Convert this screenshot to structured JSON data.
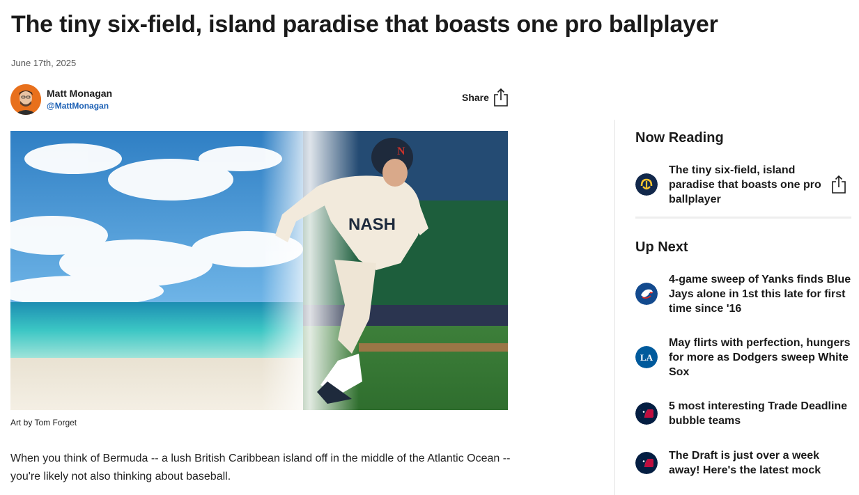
{
  "article": {
    "headline": "The tiny six-field, island paradise that boasts one pro ballplayer",
    "date": "June 17th, 2025",
    "author": {
      "name": "Matt Monagan",
      "handle": "@MattMonagan"
    },
    "share_label": "Share",
    "hero_caption": "Art by Tom Forget",
    "body": "When you think of Bermuda -- a lush British Caribbean island off in the middle of the Atlantic Ocean -- you're likely not also thinking about baseball.",
    "hero_jersey_text": "NASH",
    "hero_helmet_letter": "N"
  },
  "sidebar": {
    "now_reading_heading": "Now Reading",
    "now_reading": {
      "title": "The tiny six-field, island paradise that boasts one pro ballplayer",
      "logo": "brewers-logo-icon"
    },
    "up_next_heading": "Up Next",
    "up_next": [
      {
        "title": "4-game sweep of Yanks finds Blue Jays alone in 1st this late for first time since '16",
        "logo": "blue-jays-logo-icon"
      },
      {
        "title": "May flirts with perfection, hungers for more as Dodgers sweep White Sox",
        "logo": "dodgers-logo-icon"
      },
      {
        "title": "5 most interesting Trade Deadline bubble teams",
        "logo": "mlb-logo-icon"
      },
      {
        "title": "The Draft is just over a week away! Here's the latest mock",
        "logo": "mlb-logo-icon"
      }
    ]
  },
  "colors": {
    "brewers_navy": "#12284b",
    "brewers_gold": "#ffc52f",
    "blue_jays": "#134a8e",
    "dodgers": "#005a9c",
    "mlb_navy": "#041e42",
    "mlb_red": "#bf0d3e",
    "link_blue": "#1a5fb4"
  }
}
